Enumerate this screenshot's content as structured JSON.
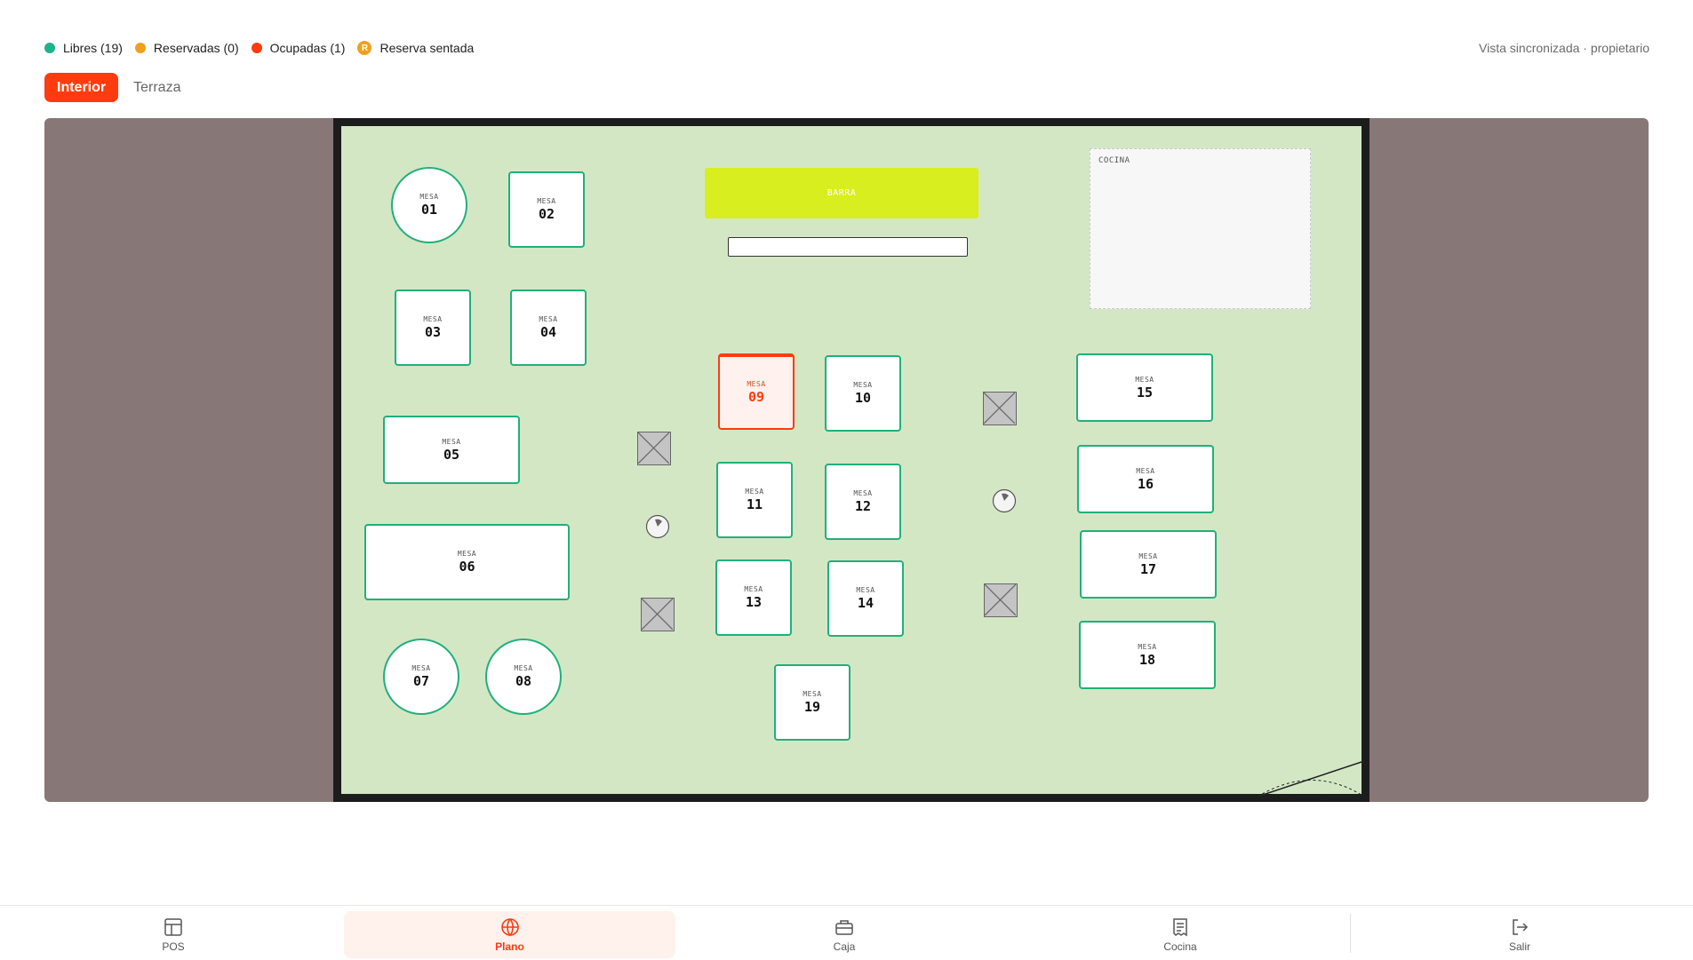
{
  "legend": {
    "free": {
      "label": "Libres (19)",
      "color": "#1fb38a"
    },
    "reserved": {
      "label": "Reservadas (0)",
      "color": "#f0a020"
    },
    "occupied": {
      "label": "Ocupadas (1)",
      "color": "#ff3b0f"
    },
    "seated": {
      "badge": "R",
      "label": "Reserva sentada",
      "color": "#f0a020"
    }
  },
  "sync_status": "Vista sincronizada · propietario",
  "tabs": {
    "interior": "Interior",
    "terrace": "Terraza",
    "active": "Interior"
  },
  "floor": {
    "bar_label": "BARRA",
    "kitchen_label": "COCINA",
    "tables": [
      {
        "label": "MESA",
        "number": "01",
        "shape": "round",
        "status": "free"
      },
      {
        "label": "MESA",
        "number": "02",
        "shape": "square",
        "status": "free"
      },
      {
        "label": "MESA",
        "number": "03",
        "shape": "square",
        "status": "free"
      },
      {
        "label": "MESA",
        "number": "04",
        "shape": "square",
        "status": "free"
      },
      {
        "label": "MESA",
        "number": "05",
        "shape": "rect",
        "status": "free"
      },
      {
        "label": "MESA",
        "number": "06",
        "shape": "rect",
        "status": "free"
      },
      {
        "label": "MESA",
        "number": "07",
        "shape": "round",
        "status": "free"
      },
      {
        "label": "MESA",
        "number": "08",
        "shape": "round",
        "status": "free"
      },
      {
        "label": "MESA",
        "number": "09",
        "shape": "square",
        "status": "occupied"
      },
      {
        "label": "MESA",
        "number": "10",
        "shape": "square",
        "status": "free"
      },
      {
        "label": "MESA",
        "number": "11",
        "shape": "square",
        "status": "free"
      },
      {
        "label": "MESA",
        "number": "12",
        "shape": "square",
        "status": "free"
      },
      {
        "label": "MESA",
        "number": "13",
        "shape": "square",
        "status": "free"
      },
      {
        "label": "MESA",
        "number": "14",
        "shape": "square",
        "status": "free"
      },
      {
        "label": "MESA",
        "number": "15",
        "shape": "rect",
        "status": "free"
      },
      {
        "label": "MESA",
        "number": "16",
        "shape": "rect",
        "status": "free"
      },
      {
        "label": "MESA",
        "number": "17",
        "shape": "rect",
        "status": "free"
      },
      {
        "label": "MESA",
        "number": "18",
        "shape": "rect",
        "status": "free"
      },
      {
        "label": "MESA",
        "number": "19",
        "shape": "square",
        "status": "free"
      }
    ]
  },
  "nav": {
    "pos": {
      "label": "POS",
      "icon": "layout-icon"
    },
    "plano": {
      "label": "Plano",
      "icon": "globe-icon"
    },
    "caja": {
      "label": "Caja",
      "icon": "register-icon"
    },
    "cocina": {
      "label": "Cocina",
      "icon": "receipt-icon"
    },
    "salir": {
      "label": "Salir",
      "icon": "logout-icon"
    },
    "active": "Plano"
  }
}
